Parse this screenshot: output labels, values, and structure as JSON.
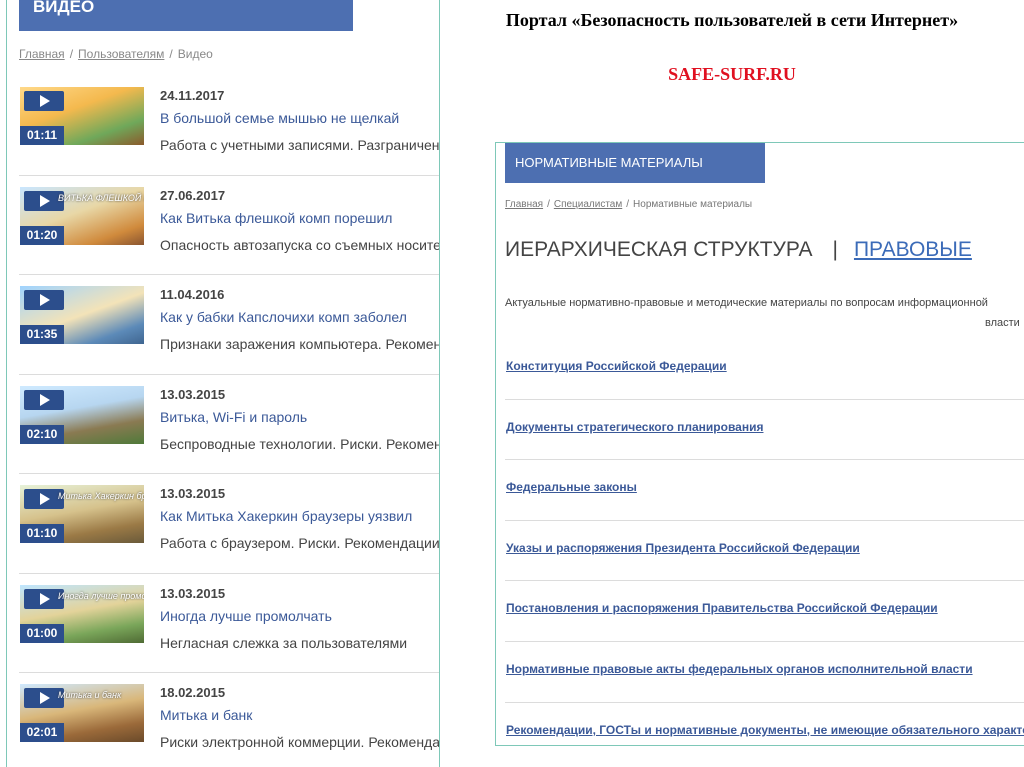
{
  "left": {
    "header": "ВИДЕО",
    "breadcrumb": {
      "home": "Главная",
      "users": "Пользователям",
      "current": "Видео"
    },
    "videos": [
      {
        "date": "24.11.2017",
        "title": "В большой семье мышью не щелкай",
        "desc": "Работа с учетными записями. Разграничение",
        "duration": "01:11",
        "caption": ""
      },
      {
        "date": "27.06.2017",
        "title": "Как Витька флешкой комп порешил",
        "desc": "Опасность автозапуска со съемных носителей",
        "duration": "01:20",
        "caption": "ВИТЬКА ФЛЕШКОЙ ПОРЕШИЛ"
      },
      {
        "date": "11.04.2016",
        "title": "Как у бабки Капслочихи комп заболел",
        "desc": "Признаки заражения компьютера. Рекомендации",
        "duration": "01:35",
        "caption": ""
      },
      {
        "date": "13.03.2015",
        "title": "Витька, Wi-Fi и пароль",
        "desc": "Беспроводные технологии. Риски. Рекомендации",
        "duration": "02:10",
        "caption": ""
      },
      {
        "date": "13.03.2015",
        "title": "Как Митька Хакеркин браузеры уязвил",
        "desc": "Работа с браузером. Риски. Рекомендации",
        "duration": "01:10",
        "caption": "Митька Хакеркин браузеры уязвил"
      },
      {
        "date": "13.03.2015",
        "title": "Иногда лучше промолчать",
        "desc": "Негласная слежка за пользователями",
        "duration": "01:00",
        "caption": "Иногда лучше промолчать"
      },
      {
        "date": "18.02.2015",
        "title": "Митька и банк",
        "desc": "Риски электронной коммерции. Рекомендации",
        "duration": "02:01",
        "caption": "Митька и банк"
      }
    ]
  },
  "portal_title": "Портал «Безопасность пользователей в сети Интернет»",
  "site_name": "SAFE-SURF.RU",
  "right": {
    "header": "НОРМАТИВНЫЕ МАТЕРИАЛЫ",
    "breadcrumb": {
      "home": "Главная",
      "specialists": "Специалистам",
      "current": "Нормативные материалы"
    },
    "title_main": "ИЕРАРХИЧЕСКАЯ СТРУКТУРА",
    "title_sep": "|",
    "title_link": "ПРАВОВЫЕ",
    "intro": "Актуальные нормативно-правовые и методические материалы по вопросам информационной",
    "intro_line2": "власти",
    "docs": [
      "Конституция Российской Федерации",
      "Документы стратегического планирования",
      "Федеральные законы",
      "Указы и распоряжения Президента Российской Федерации",
      "Постановления и распоряжения Правительства Российской Федерации",
      "Нормативные правовые акты федеральных органов исполнительной власти",
      "Рекомендации, ГОСТы и нормативные документы, не имеющие обязательного характера"
    ]
  }
}
